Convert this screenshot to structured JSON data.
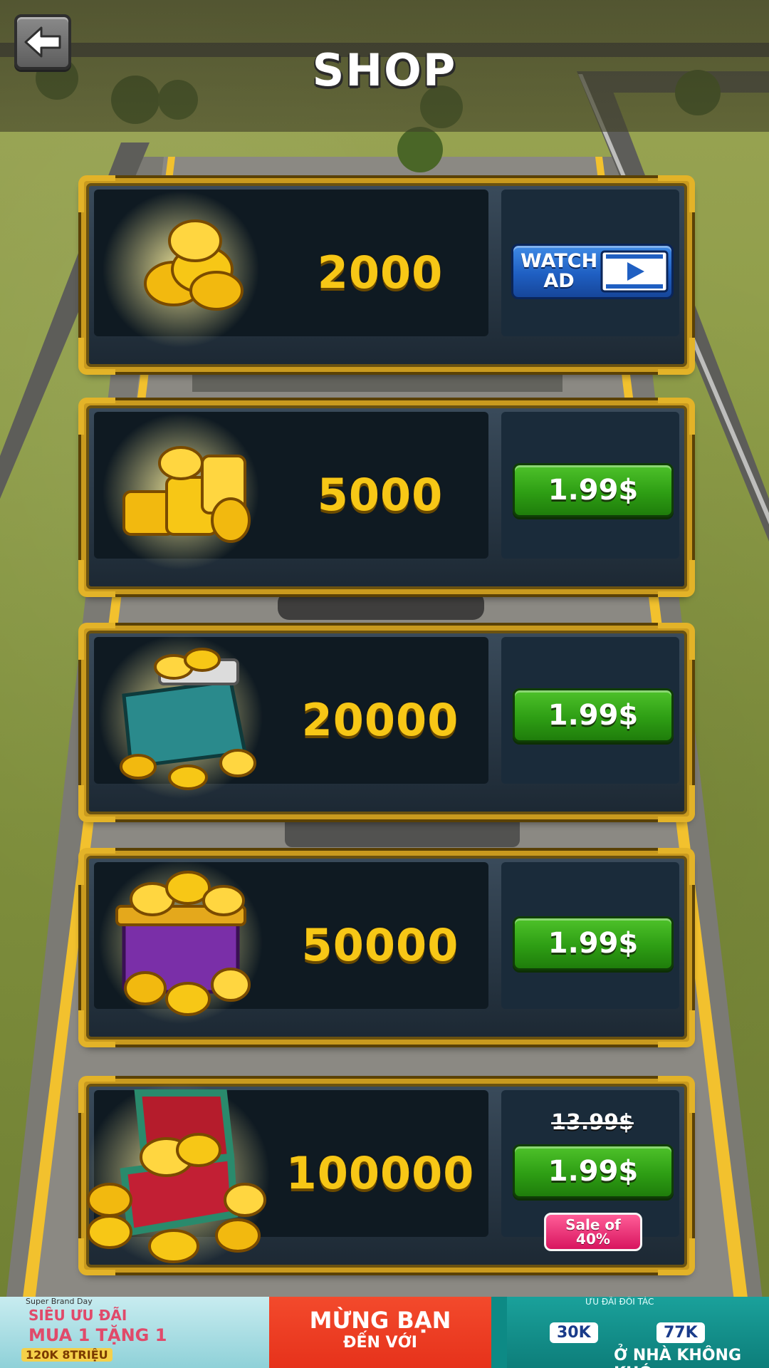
{
  "header": {
    "title": "SHOP",
    "back_icon": "back-arrow-icon"
  },
  "items": [
    {
      "amount": "2000",
      "action": "watch",
      "button_label": "WATCH\nAD",
      "icon": "coin-pile-small-icon"
    },
    {
      "amount": "5000",
      "action": "buy",
      "price": "1.99$",
      "icon": "coin-stack-icon"
    },
    {
      "amount": "20000",
      "action": "buy",
      "price": "1.99$",
      "icon": "coin-bag-icon"
    },
    {
      "amount": "50000",
      "action": "buy",
      "price": "1.99$",
      "icon": "coin-box-icon"
    },
    {
      "amount": "100000",
      "action": "buy",
      "price": "1.99$",
      "old_price": "13.99$",
      "sale_label": "Sale of\n40%",
      "icon": "treasure-chest-icon"
    }
  ],
  "ad": {
    "left_top": "Super Brand Day",
    "left_line1": "SIÊU ƯU ĐÃI",
    "left_line2": "MUA 1 TẶNG 1",
    "left_line3": "120K   8TRIỆU",
    "mid_line1": "MỪNG BẠN",
    "mid_line2": "ĐẾN VỚI",
    "right_top": "ƯU ĐÃI ĐỐI TÁC",
    "right_val1": "30K",
    "right_val2": "77K",
    "right_line": "Ở NHÀ KHÔNG KHÓ"
  },
  "colors": {
    "gold": "#f7c716",
    "frame": "#c99a1e",
    "buy_button": "#2e9e14",
    "watch_button": "#1f5fc2",
    "sale_badge": "#d8155f"
  }
}
